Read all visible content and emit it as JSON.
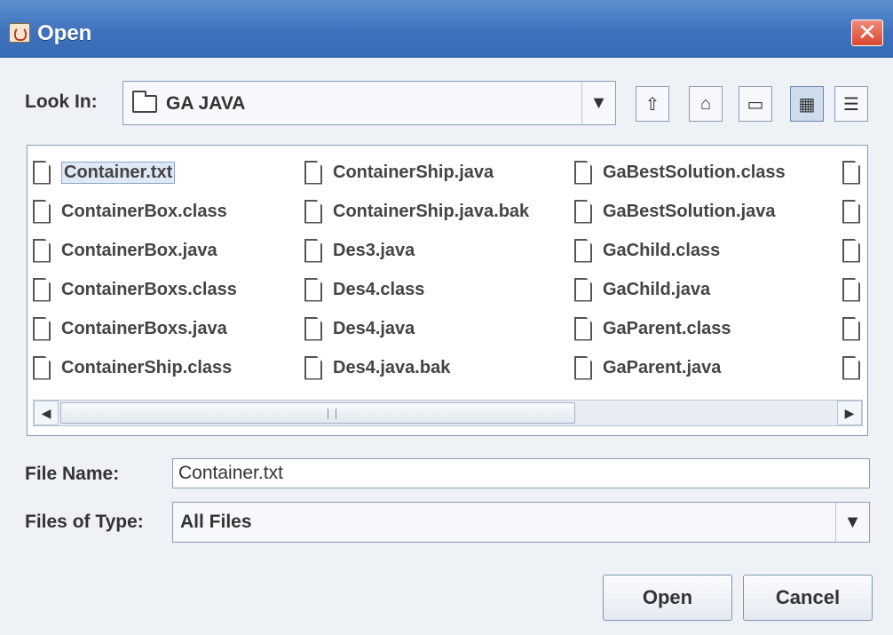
{
  "window": {
    "title": "Open",
    "close_symbol": "✕"
  },
  "look_in": {
    "label": "Look In:",
    "value": "GA JAVA",
    "arrow": "▼"
  },
  "toolbar": {
    "up_symbol": "⇧",
    "home_symbol": "⌂",
    "new_folder_symbol": "▭",
    "list_symbol": "▦",
    "details_symbol": "☰"
  },
  "files": {
    "column1": [
      "Container.txt",
      "ContainerBox.class",
      "ContainerBox.java",
      "ContainerBoxs.class",
      "ContainerBoxs.java",
      "ContainerShip.class"
    ],
    "column2": [
      "ContainerShip.java",
      "ContainerShip.java.bak",
      "Des3.java",
      "Des4.class",
      "Des4.java",
      "Des4.java.bak"
    ],
    "column3": [
      "GaBestSolution.class",
      "GaBestSolution.java",
      "GaChild.class",
      "GaChild.java",
      "GaParent.class",
      "GaParent.java"
    ],
    "selected": "Container.txt"
  },
  "scrollbar": {
    "left_arrow": "◀",
    "right_arrow": "▶"
  },
  "file_name": {
    "label": "File Name:",
    "value": "Container.txt"
  },
  "files_of_type": {
    "label": "Files of Type:",
    "value": "All Files",
    "arrow": "▼"
  },
  "buttons": {
    "open": "Open",
    "cancel": "Cancel"
  },
  "colors": {
    "titlebar": "#3f72bd",
    "close": "#d9472f",
    "dialog_bg": "#eef2f7"
  }
}
